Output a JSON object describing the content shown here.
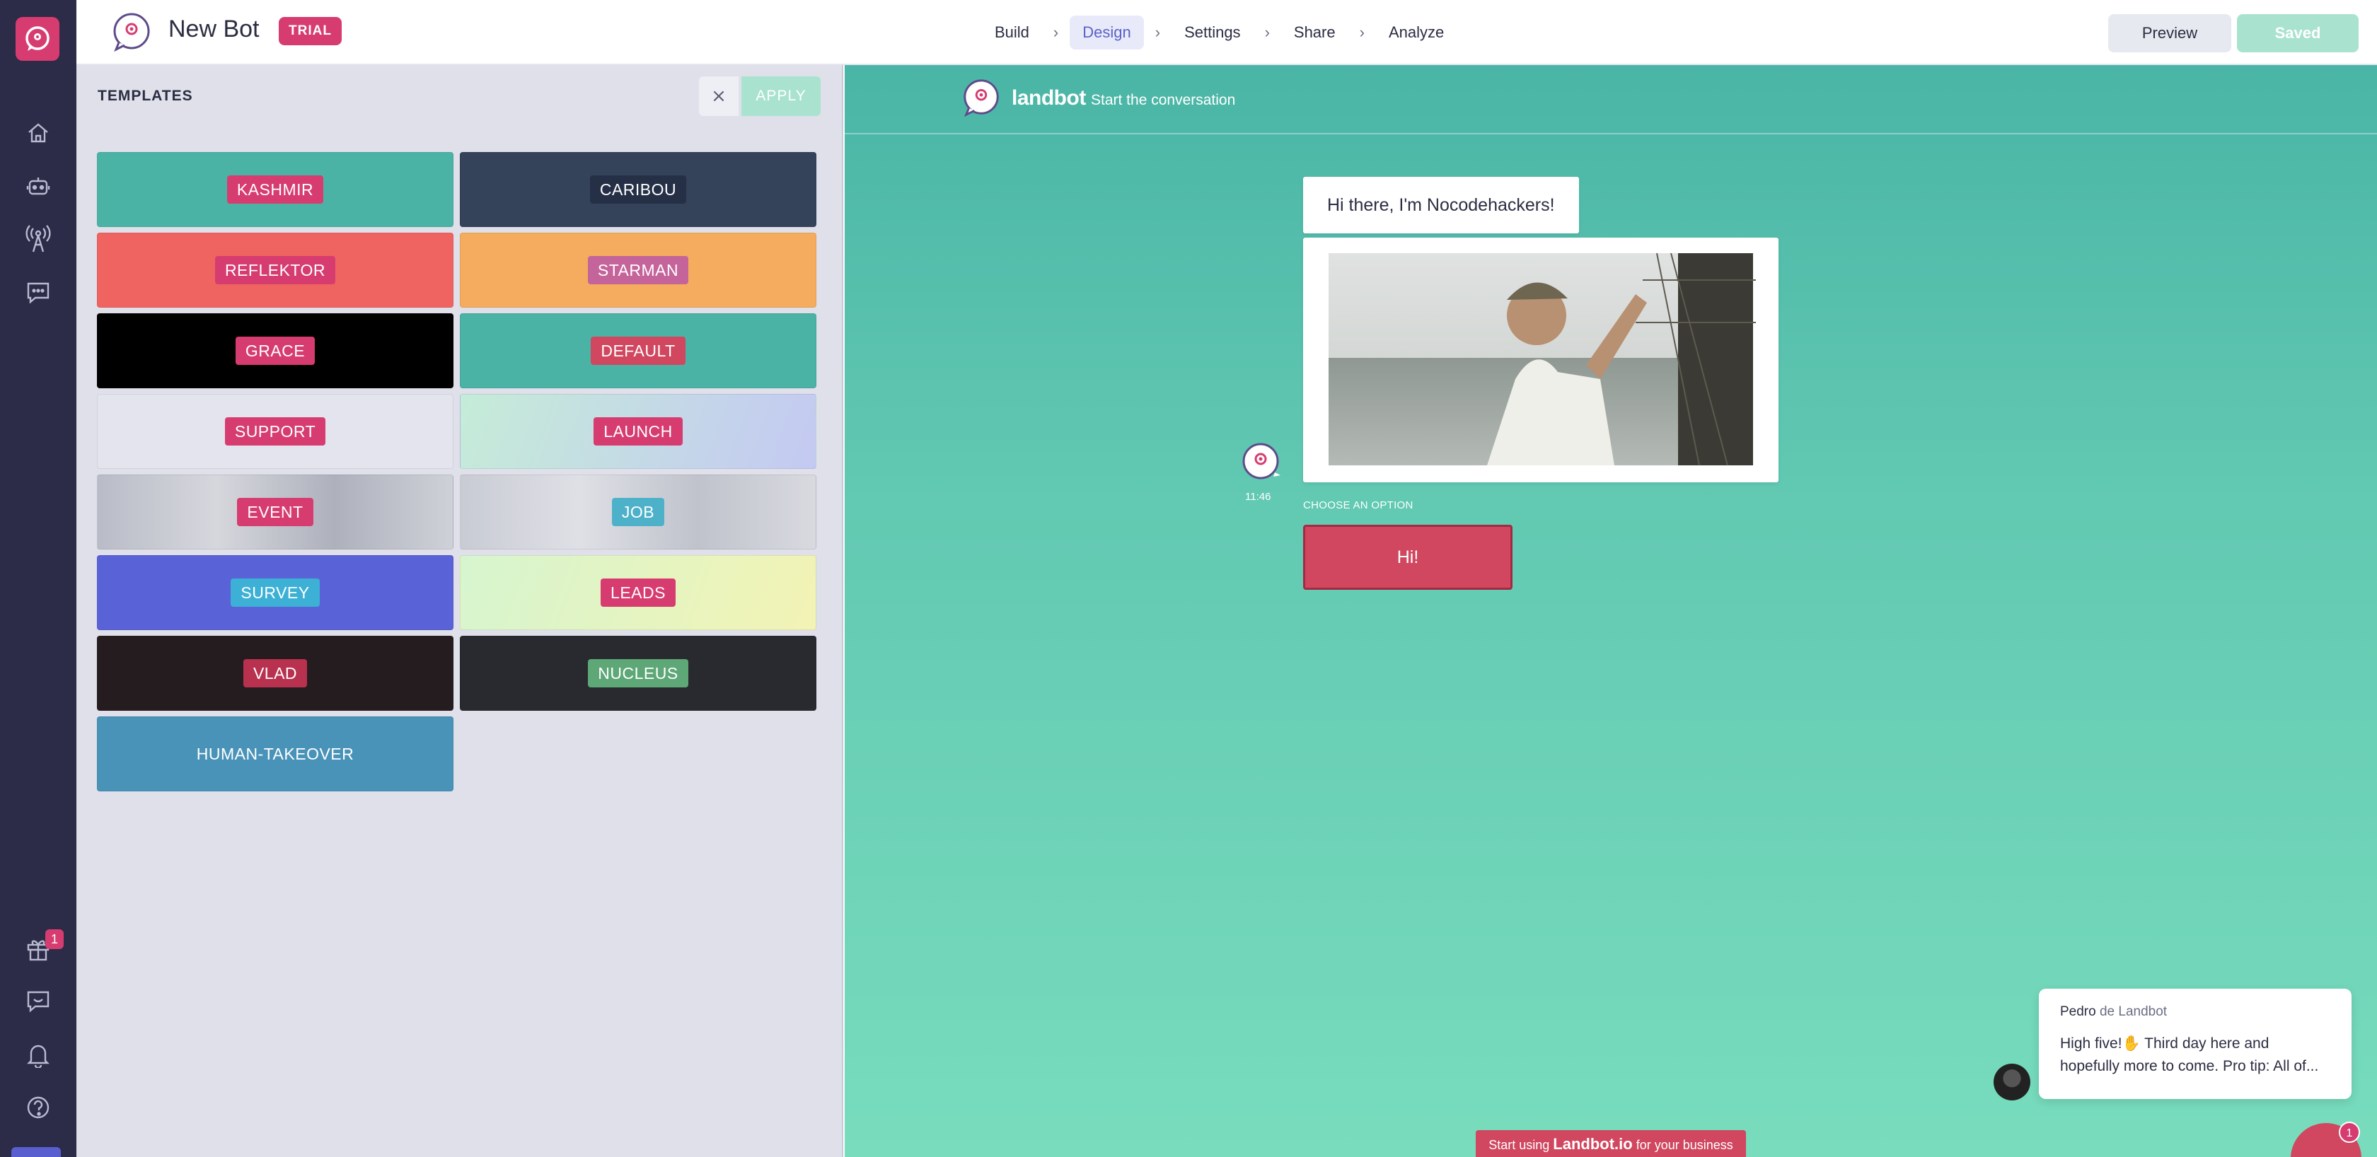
{
  "app": {
    "bot_name": "New Bot",
    "trial_badge": "TRIAL",
    "rail_gift_count": "1"
  },
  "nav": {
    "items": [
      {
        "label": "Build",
        "active": false
      },
      {
        "label": "Design",
        "active": true
      },
      {
        "label": "Settings",
        "active": false
      },
      {
        "label": "Share",
        "active": false
      },
      {
        "label": "Analyze",
        "active": false
      }
    ],
    "separator": "›"
  },
  "actions": {
    "preview_label": "Preview",
    "saved_label": "Saved"
  },
  "panel": {
    "title": "TEMPLATES",
    "close_glyph": "×",
    "apply_label": "APPLY",
    "templates": [
      {
        "name": "KASHMIR",
        "bg": "#4bb3a6",
        "label_bg": "#d63c6f"
      },
      {
        "name": "CARIBOU",
        "bg": "#34435a",
        "label_bg": "#253046"
      },
      {
        "name": "REFLEKTOR",
        "bg": "#ef6461",
        "label_bg": "#d63c6f"
      },
      {
        "name": "STARMAN",
        "bg": "#f5ac5f",
        "label_bg": "#c4649a"
      },
      {
        "name": "GRACE",
        "bg": "#000000",
        "label_bg": "#d63c6f"
      },
      {
        "name": "DEFAULT",
        "bg": "#4bb3a6",
        "label_bg": "#d0475f"
      },
      {
        "name": "SUPPORT",
        "bg": "#e4e4ee",
        "label_bg": "#d63c6f"
      },
      {
        "name": "LAUNCH",
        "bg": "linear-gradient(110deg,#c5ecd8,#c4c9f2)",
        "label_bg": "#d63c6f"
      },
      {
        "name": "EVENT",
        "bg": "linear-gradient(90deg,#b9bcc7,#d6d7dd,#aeb1bc,#cfd1d8)",
        "label_bg": "#d63c6f"
      },
      {
        "name": "JOB",
        "bg": "linear-gradient(90deg,#c9cbd4,#dfe0e6,#c0c3cc,#d9dae0)",
        "label_bg": "#4db1c9"
      },
      {
        "name": "SURVEY",
        "bg": "#5a62d7",
        "label_bg": "#3db0d6"
      },
      {
        "name": "LEADS",
        "bg": "linear-gradient(110deg,#d6f5cf,#f3f3b4)",
        "label_bg": "#d63c6f"
      },
      {
        "name": "VLAD",
        "bg": "#251c1f",
        "label_bg": "#b8314f"
      },
      {
        "name": "NUCLEUS",
        "bg": "#292a2f",
        "label_bg": "#5ea777"
      },
      {
        "name": "HUMAN-TAKEOVER",
        "bg": "#4993b9",
        "label_bg": "#4993b9"
      }
    ]
  },
  "preview": {
    "brand": "landbot",
    "subtitle": "Start the conversation",
    "greeting": "Hi there, I'm Nocodehackers!",
    "time": "11:46",
    "choose_label": "CHOOSE AN OPTION",
    "option_button": "Hi!",
    "cta_prefix": "Start using",
    "cta_brand": "Landbot.io",
    "cta_suffix": "for your business"
  },
  "chat_popup": {
    "from_name": "Pedro",
    "from_suffix": "de Landbot",
    "message": "High five!✋ Third day here and hopefully more to come. Pro tip: All of...",
    "launcher_badge": "1"
  },
  "colors": {
    "accent": "#d63c6f",
    "rail": "#2c2b48",
    "panel": "#dfe0ea",
    "preview_top": "#4ab5a6",
    "preview_bottom": "#78dcbd",
    "saved_btn": "#a9e3cf"
  },
  "icons": [
    "landbot-logo-icon",
    "home-icon",
    "bot-icon",
    "broadcast-icon",
    "chat-icon",
    "gift-icon",
    "feedback-icon",
    "bell-icon",
    "help-icon",
    "close-icon"
  ]
}
